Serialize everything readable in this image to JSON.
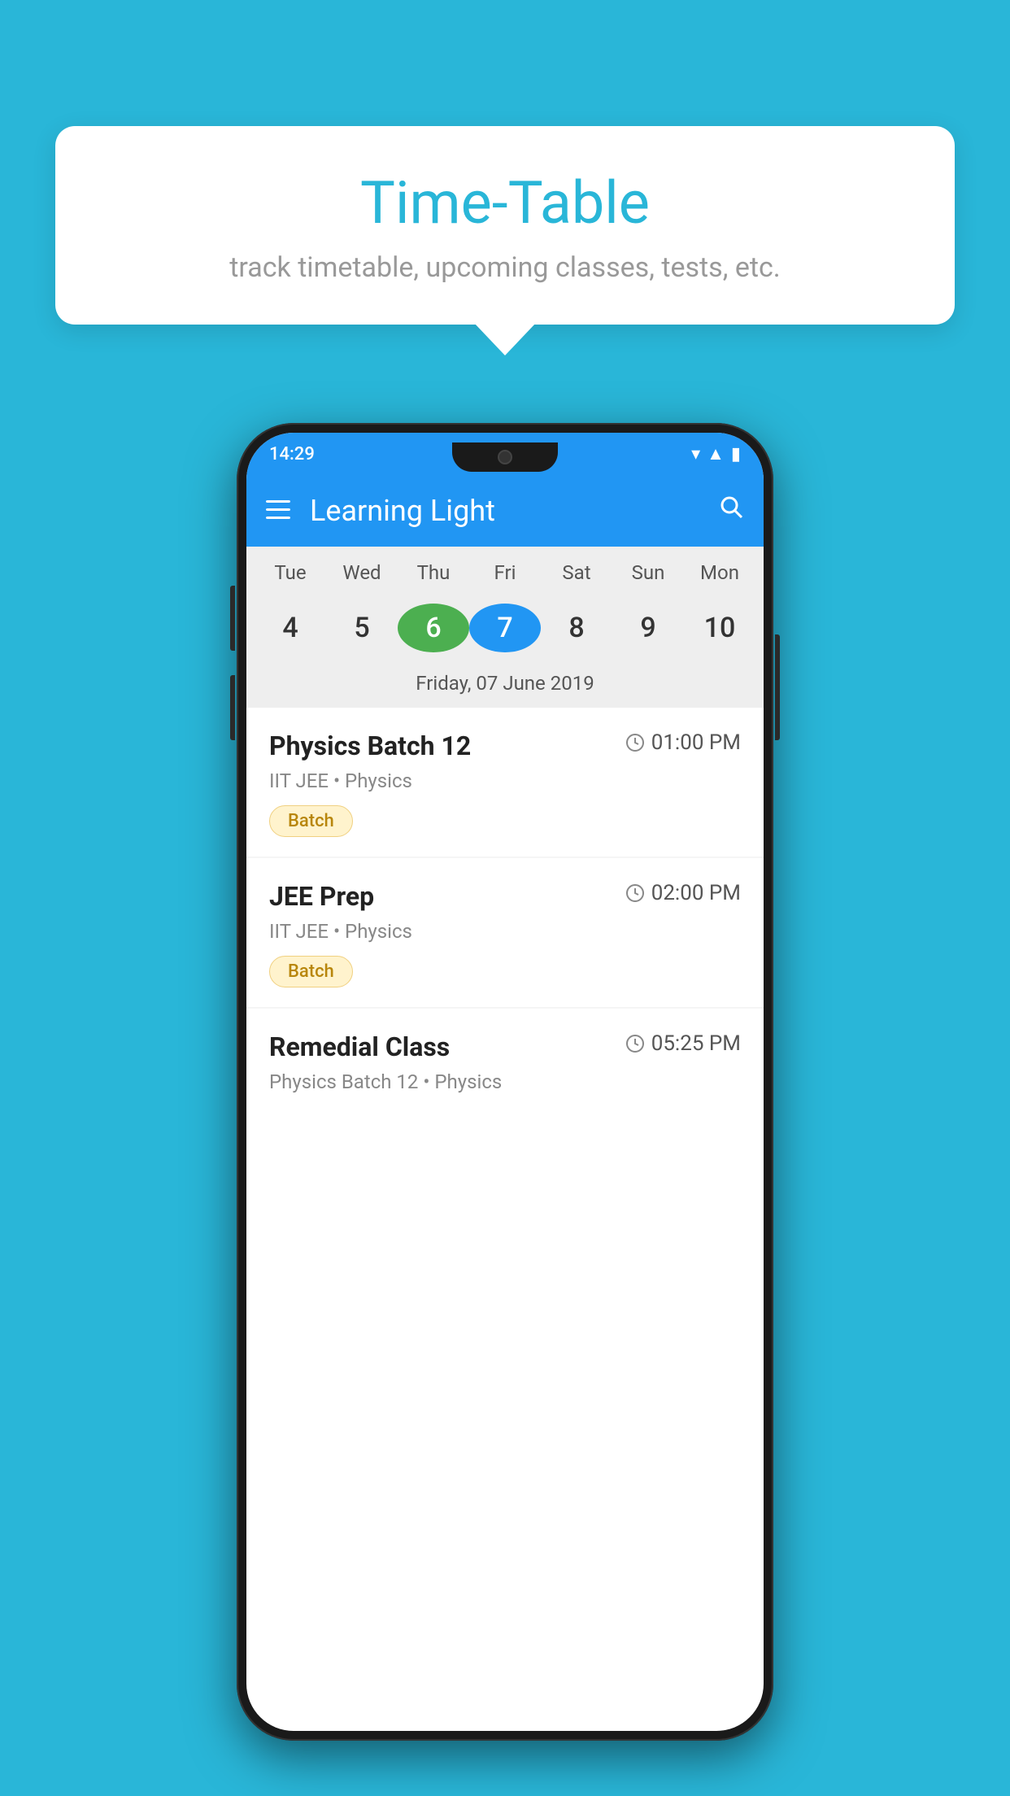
{
  "background_color": "#29b6d8",
  "tooltip": {
    "title": "Time-Table",
    "subtitle": "track timetable, upcoming classes, tests, etc."
  },
  "status_bar": {
    "time": "14:29",
    "icons": [
      "wifi",
      "signal",
      "battery"
    ]
  },
  "app_bar": {
    "title": "Learning Light",
    "menu_icon": "☰",
    "search_icon": "🔍"
  },
  "calendar": {
    "days": [
      {
        "label": "Tue",
        "num": "4"
      },
      {
        "label": "Wed",
        "num": "5"
      },
      {
        "label": "Thu",
        "num": "6",
        "state": "today"
      },
      {
        "label": "Fri",
        "num": "7",
        "state": "selected"
      },
      {
        "label": "Sat",
        "num": "8"
      },
      {
        "label": "Sun",
        "num": "9"
      },
      {
        "label": "Mon",
        "num": "10"
      }
    ],
    "selected_date": "Friday, 07 June 2019"
  },
  "schedule": [
    {
      "id": "item1",
      "title": "Physics Batch 12",
      "time": "01:00 PM",
      "subtitle": "IIT JEE • Physics",
      "tag": "Batch"
    },
    {
      "id": "item2",
      "title": "JEE Prep",
      "time": "02:00 PM",
      "subtitle": "IIT JEE • Physics",
      "tag": "Batch"
    },
    {
      "id": "item3",
      "title": "Remedial Class",
      "time": "05:25 PM",
      "subtitle": "Physics Batch 12 • Physics",
      "tag": null
    }
  ]
}
